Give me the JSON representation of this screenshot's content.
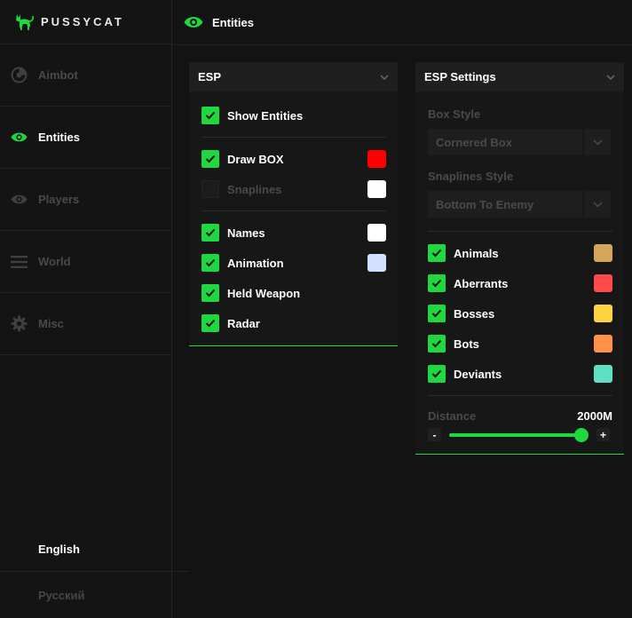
{
  "brand": {
    "name": "PUSSYCAT",
    "accent": "#1fd83f"
  },
  "sidebar": {
    "items": [
      {
        "label": "Aimbot",
        "icon": "aimbot-icon",
        "active": false
      },
      {
        "label": "Entities",
        "icon": "eye-icon",
        "active": true
      },
      {
        "label": "Players",
        "icon": "eye-icon",
        "active": false
      },
      {
        "label": "World",
        "icon": "menu-lines-icon",
        "active": false
      },
      {
        "label": "Misc",
        "icon": "gear-icon",
        "active": false
      }
    ],
    "languages": [
      "English",
      "Русский"
    ],
    "active_language": "English"
  },
  "header": {
    "title": "Entities",
    "icon": "eye-icon"
  },
  "esp": {
    "title": "ESP",
    "show_entities": {
      "label": "Show Entities",
      "checked": true
    },
    "draw_box": {
      "label": "Draw BOX",
      "checked": true,
      "color": "#ff0000"
    },
    "snaplines": {
      "label": "Snaplines",
      "checked": false,
      "color": "#ffffff"
    },
    "names": {
      "label": "Names",
      "checked": true,
      "color": "#ffffff"
    },
    "animation": {
      "label": "Animation",
      "checked": true,
      "color": "#d4e0ff"
    },
    "held_weapon": {
      "label": "Held Weapon",
      "checked": true
    },
    "radar": {
      "label": "Radar",
      "checked": true
    }
  },
  "esp_settings": {
    "title": "ESP Settings",
    "box_style": {
      "label": "Box Style",
      "value": "Cornered Box"
    },
    "snaplines_style": {
      "label": "Snaplines Style",
      "value": "Bottom To Enemy"
    },
    "animals": {
      "label": "Animals",
      "checked": true,
      "color": "#d4a65a"
    },
    "aberrants": {
      "label": "Aberrants",
      "checked": true,
      "color": "#ff4a4a"
    },
    "bosses": {
      "label": "Bosses",
      "checked": true,
      "color": "#ffd23f"
    },
    "bots": {
      "label": "Bots",
      "checked": true,
      "color": "#ff9148"
    },
    "deviants": {
      "label": "Deviants",
      "checked": true,
      "color": "#5ee0c2"
    },
    "distance": {
      "label": "Distance",
      "value_text": "2000M",
      "fraction": 0.99,
      "minus": "-",
      "plus": "+"
    }
  }
}
